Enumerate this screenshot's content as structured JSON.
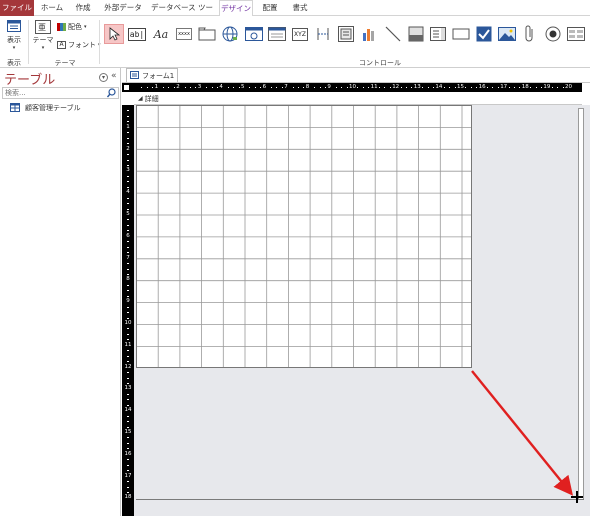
{
  "tabs": [
    {
      "label": "ファイル"
    },
    {
      "label": "ホーム"
    },
    {
      "label": "作成"
    },
    {
      "label": "外部データ"
    },
    {
      "label": "データベース ツール"
    },
    {
      "label": "デザイン"
    },
    {
      "label": "配置"
    },
    {
      "label": "書式"
    }
  ],
  "ribbon": {
    "view_label": "表示",
    "view_group": "表示",
    "theme_label": "テーマ",
    "colors_label": "配色",
    "fonts_label": "フォント",
    "theme_group": "テーマ",
    "controls_group": "コントロール",
    "text_box_glyph": "ab|",
    "label_glyph": "Aa",
    "password_glyph": "xxxx",
    "xyz_glyph": "XYZ"
  },
  "nav": {
    "title": "テーブル",
    "search_placeholder": "検索...",
    "items": [
      {
        "label": "顧客管理テーブル"
      }
    ]
  },
  "doc": {
    "tab_label": "フォーム1",
    "section_label": "詳細",
    "hruler_numbers": [
      "1",
      "2",
      "3",
      "4",
      "5",
      "6",
      "7",
      "8",
      "9",
      "10",
      "11",
      "12",
      "13",
      "14",
      "15",
      "16",
      "17",
      "18",
      "19",
      "20"
    ],
    "vruler_numbers": [
      "1",
      "2",
      "3",
      "4",
      "5",
      "6",
      "7",
      "8",
      "9",
      "10",
      "11",
      "12",
      "13",
      "14",
      "15",
      "16",
      "17",
      "18"
    ]
  },
  "colors": {
    "file_tab": "#a4373a",
    "active_tab_text": "#7030a0",
    "arrow": "#e02020",
    "ruler": "#000000",
    "gray_area": "#e7e8ec"
  }
}
